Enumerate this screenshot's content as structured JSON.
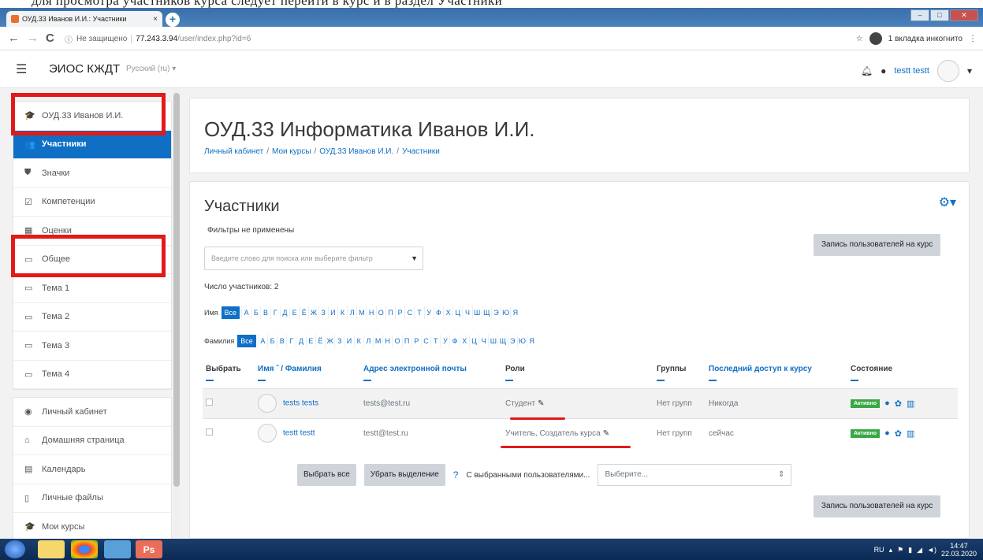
{
  "browser": {
    "tab_title": "ОУД.33 Иванов И.И.: Участники",
    "tab_close": "×",
    "new_tab": "+",
    "back": "←",
    "forward": "→",
    "reload": "C",
    "security": "Не защищено",
    "url_host": "77.243.3.94",
    "url_path": "/user/index.php?id=6",
    "incognito": "1 вкладка инкогнито",
    "minimize": "–",
    "maximize": "□",
    "close": "✕"
  },
  "navbar": {
    "brand": "ЭИОС КЖДТ",
    "language": "Русский (ru) ▾",
    "user_name": "testt testt"
  },
  "drawer": {
    "course_items": [
      {
        "icon": "graduation-cap-icon",
        "glyph": "🎓",
        "label": "ОУД.33 Иванов И.И.",
        "active": false
      },
      {
        "icon": "users-icon",
        "glyph": "👥",
        "label": "Участники",
        "active": true
      },
      {
        "icon": "shield-icon",
        "glyph": "⛊",
        "label": "Значки",
        "active": false
      },
      {
        "icon": "checkbox-icon",
        "glyph": "☑",
        "label": "Компетенции",
        "active": false
      },
      {
        "icon": "table-icon",
        "glyph": "▦",
        "label": "Оценки",
        "active": false
      },
      {
        "icon": "folder-icon",
        "glyph": "▭",
        "label": "Общее",
        "active": false
      },
      {
        "icon": "folder-icon",
        "glyph": "▭",
        "label": "Тема 1",
        "active": false
      },
      {
        "icon": "folder-icon",
        "glyph": "▭",
        "label": "Тема 2",
        "active": false
      },
      {
        "icon": "folder-icon",
        "glyph": "▭",
        "label": "Тема 3",
        "active": false
      },
      {
        "icon": "folder-icon",
        "glyph": "▭",
        "label": "Тема 4",
        "active": false
      }
    ],
    "site_items": [
      {
        "icon": "dashboard-icon",
        "glyph": "◉",
        "label": "Личный кабинет"
      },
      {
        "icon": "home-icon",
        "glyph": "⌂",
        "label": "Домашняя страница"
      },
      {
        "icon": "calendar-icon",
        "glyph": "▤",
        "label": "Календарь"
      },
      {
        "icon": "file-icon",
        "glyph": "▯",
        "label": "Личные файлы"
      },
      {
        "icon": "graduation-cap-icon",
        "glyph": "🎓",
        "label": "Мои курсы"
      }
    ]
  },
  "header": {
    "title": "ОУД.33 Информатика Иванов И.И.",
    "breadcrumb": [
      "Личный кабинет",
      "Мои курсы",
      "ОУД.33 Иванов И.И.",
      "Участники"
    ]
  },
  "participants": {
    "title": "Участники",
    "filters_status": "Фильтры не применены",
    "enrol_button": "Запись пользователей на курс",
    "search_placeholder": "Введите слово для поиска или выберите фильтр",
    "count_text": "Число участников: 2",
    "firstname_label": "Имя",
    "lastname_label": "Фамилия",
    "all_label": "Все",
    "letters": [
      "А",
      "Б",
      "В",
      "Г",
      "Д",
      "Е",
      "Ё",
      "Ж",
      "З",
      "И",
      "К",
      "Л",
      "М",
      "Н",
      "О",
      "П",
      "Р",
      "С",
      "Т",
      "У",
      "Ф",
      "Х",
      "Ц",
      "Ч",
      "Ш",
      "Щ",
      "Э",
      "Ю",
      "Я"
    ],
    "columns": {
      "select": "Выбрать",
      "name": "Имя ˆ / Фамилия",
      "email": "Адрес электронной почты",
      "roles": "Роли",
      "groups": "Группы",
      "last_access": "Последний доступ к курсу",
      "status": "Состояние"
    },
    "rows": [
      {
        "name": "tests tests",
        "email": "tests@test.ru",
        "roles": "Студент",
        "groups": "Нет групп",
        "last_access": "Никогда",
        "status": "Активно"
      },
      {
        "name": "testt testt",
        "email": "testt@test.ru",
        "roles": "Учитель, Создатель курса",
        "groups": "Нет групп",
        "last_access": "сейчас",
        "status": "Активно"
      }
    ],
    "select_all": "Выбрать все",
    "deselect_all": "Убрать выделение",
    "with_selected": "С выбранными пользователями...",
    "choose_placeholder": "Выберите..."
  },
  "taskbar": {
    "lang": "RU",
    "time": "14:47",
    "date": "22.03.2020"
  },
  "caption_text": "для просмотра участников курса следует перейти в курс и в раздел Участники"
}
